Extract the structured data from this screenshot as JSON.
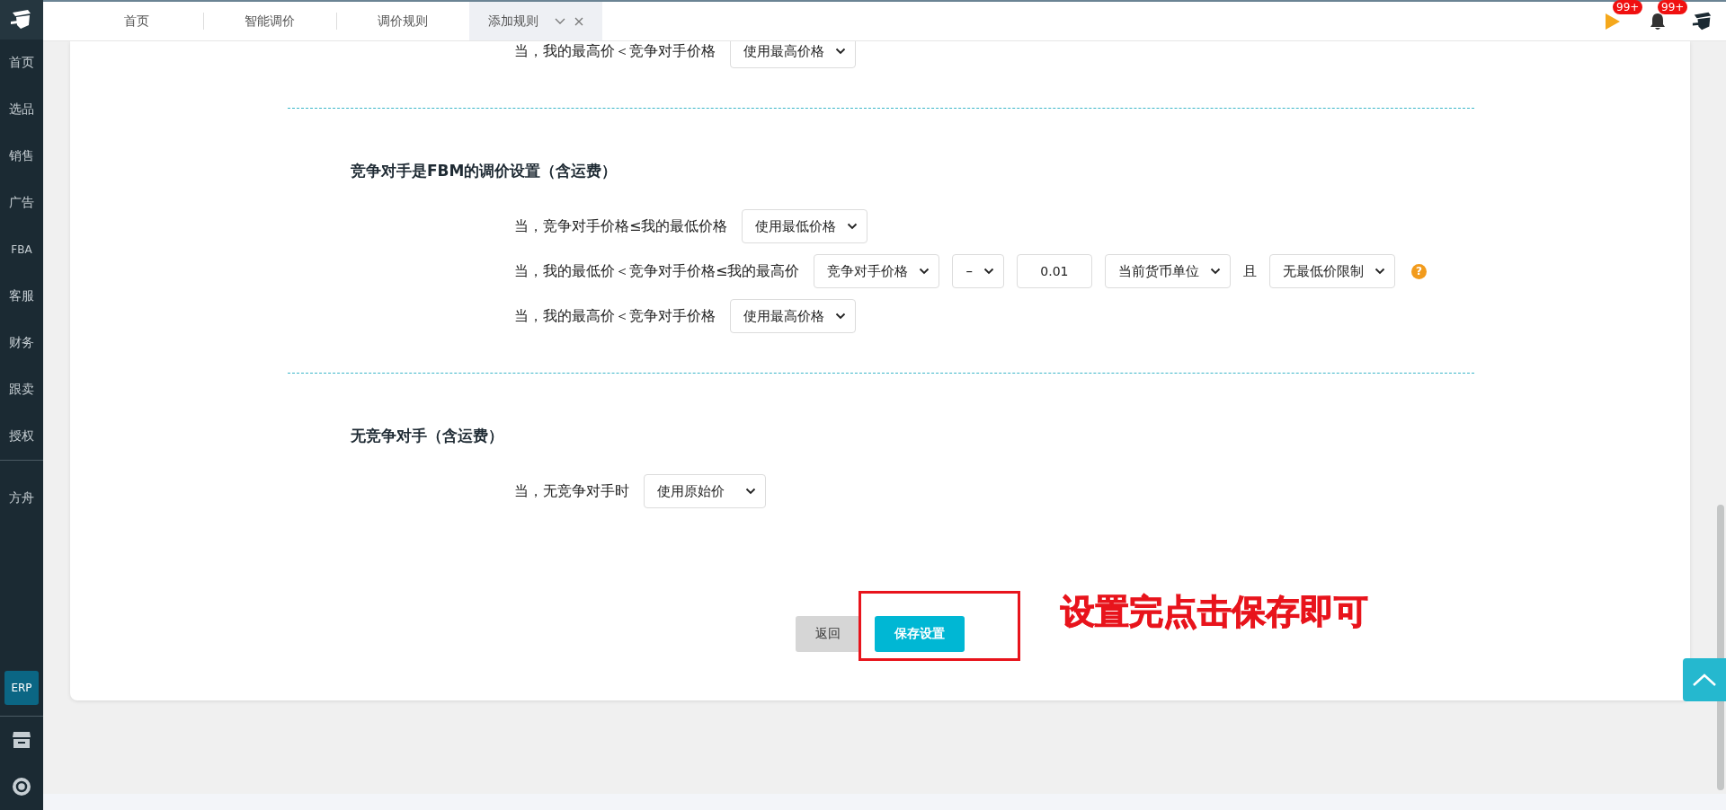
{
  "sidebar": {
    "items": [
      {
        "label": "首页",
        "selected": false
      },
      {
        "label": "选品",
        "selected": false
      },
      {
        "label": "销售",
        "selected": false
      },
      {
        "label": "广告",
        "selected": false
      },
      {
        "label": "FBA",
        "selected": false
      },
      {
        "label": "客服",
        "selected": false
      },
      {
        "label": "财务",
        "selected": false
      },
      {
        "label": "跟卖",
        "selected": false
      },
      {
        "label": "授权",
        "selected": false
      }
    ],
    "extra_items": [
      {
        "label": "方舟",
        "selected": false
      }
    ],
    "badge": "ERP"
  },
  "tabs": [
    {
      "label": "首页",
      "selected": false
    },
    {
      "label": "智能调价",
      "selected": false
    },
    {
      "label": "调价规则",
      "selected": false
    },
    {
      "label": "添加规则",
      "selected": true
    }
  ],
  "notifications": [
    {
      "kind": "flag",
      "badge": "99+"
    },
    {
      "kind": "bell",
      "badge": "99+"
    }
  ],
  "sections": [
    {
      "rows": [
        {
          "label": "当，我的最高价＜竞争对手价格",
          "controls": [
            {
              "kind": "select",
              "value": "使用最高价格"
            }
          ]
        }
      ]
    },
    {
      "title": "竞争对手是FBM的调价设置（含运费）",
      "rows": [
        {
          "label": "当，竞争对手价格≤我的最低价格",
          "controls": [
            {
              "kind": "select",
              "value": "使用最低价格"
            }
          ]
        },
        {
          "label": "当，我的最低价＜竞争对手价格≤我的最高价",
          "controls": [
            {
              "kind": "select",
              "value": "竞争对手价格"
            },
            {
              "kind": "select",
              "value": "–"
            },
            {
              "kind": "input",
              "value": "0.01"
            },
            {
              "kind": "select",
              "value": "当前货币单位"
            },
            {
              "kind": "text",
              "text": "且"
            },
            {
              "kind": "select",
              "value": "无最低价限制"
            },
            {
              "kind": "help",
              "glyph": "?"
            }
          ]
        },
        {
          "label": "当，我的最高价＜竞争对手价格",
          "controls": [
            {
              "kind": "select",
              "value": "使用最高价格"
            }
          ]
        }
      ]
    },
    {
      "title": "无竞争对手（含运费）",
      "rows": [
        {
          "label": "当，无竞争对手时",
          "controls": [
            {
              "kind": "select",
              "value": "使用原始价"
            }
          ]
        }
      ]
    }
  ],
  "buttons": [
    {
      "kind": "secondary",
      "label": "返回"
    },
    {
      "kind": "primary",
      "label": "保存设置"
    }
  ],
  "annotation": "设置完点击保存即可"
}
